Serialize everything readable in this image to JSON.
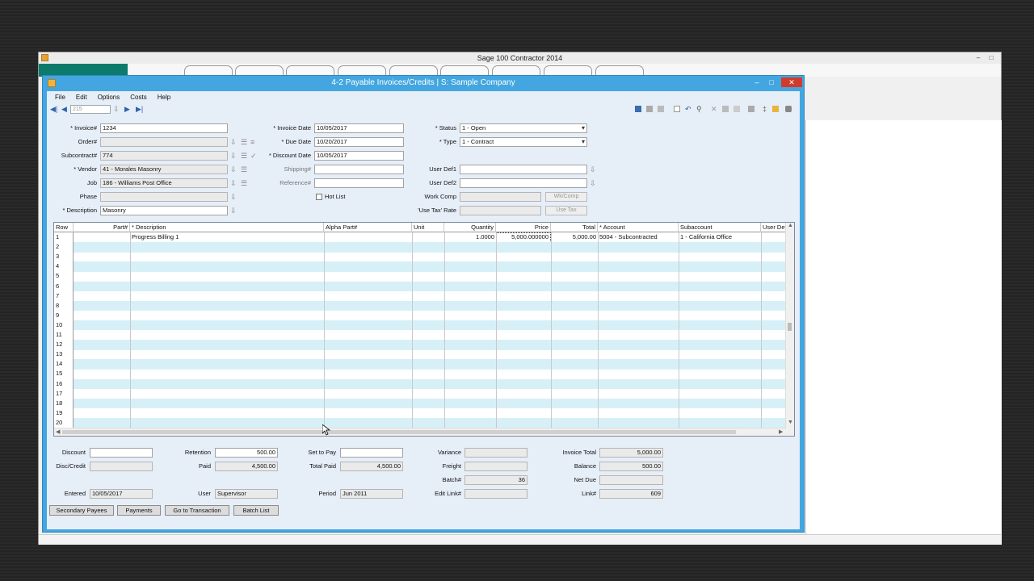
{
  "outer_window": {
    "title": "Sage 100 Contractor 2014",
    "controls": [
      "–",
      "□"
    ]
  },
  "window": {
    "title": "4-2 Payable Invoices/Credits  |  S: Sample Company",
    "controls": [
      "–",
      "□",
      "✕"
    ]
  },
  "menu": [
    "File",
    "Edit",
    "Options",
    "Costs",
    "Help"
  ],
  "toolbar": {
    "record_number": "215"
  },
  "header_left": [
    {
      "label": "* Invoice#",
      "value": "1234"
    },
    {
      "label": "Order#",
      "value": ""
    },
    {
      "label": "Subcontract#",
      "value": "774"
    },
    {
      "label": "* Vendor",
      "value": "41 - Morales Masonry"
    },
    {
      "label": "Job",
      "value": "186 - Williams Post Office"
    },
    {
      "label": "Phase",
      "value": ""
    },
    {
      "label": "* Description",
      "value": "Masonry"
    }
  ],
  "header_mid": [
    {
      "label": "* Invoice Date",
      "value": "10/05/2017"
    },
    {
      "label": "* Due Date",
      "value": "10/20/2017"
    },
    {
      "label": "* Discount Date",
      "value": "10/05/2017"
    },
    {
      "label": "Shipping#",
      "value": ""
    },
    {
      "label": "Reference#",
      "value": ""
    }
  ],
  "hot_list_label": "Hot List",
  "header_right": {
    "status_label": "* Status",
    "status_value": "1 - Open",
    "type_label": "* Type",
    "type_value": "1 - Contract",
    "userdef1_label": "User Def1",
    "userdef2_label": "User Def2",
    "workcomp_label": "Work Comp",
    "wkcomp_btn": "Wk/Comp",
    "usetax_label": "'Use Tax' Rate",
    "usetax_btn": "Use Tax"
  },
  "grid": {
    "columns": [
      "Row",
      "Part#",
      "* Description",
      "Alpha Part#",
      "Unit",
      "Quantity",
      "Price",
      "Total",
      "* Account",
      "Subaccount",
      "User Defi"
    ],
    "rows": [
      {
        "row": "1",
        "part": "",
        "description": "Progress Billing 1",
        "alpha": "",
        "unit": "",
        "quantity": "1.0000",
        "price": "5,000.000000",
        "total": "5,000.00",
        "account": "5004 - Subcontracted",
        "subaccount": "1 - California Office",
        "userdef": ""
      },
      {
        "row": "2"
      },
      {
        "row": "3"
      },
      {
        "row": "4"
      },
      {
        "row": "5"
      },
      {
        "row": "6"
      },
      {
        "row": "7"
      },
      {
        "row": "8"
      },
      {
        "row": "9"
      },
      {
        "row": "10"
      },
      {
        "row": "11"
      },
      {
        "row": "12"
      },
      {
        "row": "13"
      },
      {
        "row": "14"
      },
      {
        "row": "15"
      },
      {
        "row": "16"
      },
      {
        "row": "17"
      },
      {
        "row": "18"
      },
      {
        "row": "19"
      },
      {
        "row": "20"
      }
    ]
  },
  "totals": {
    "discount_label": "Discount",
    "discount": "",
    "disccredit_label": "Disc/Credit",
    "disccredit": "",
    "retention_label": "Retention",
    "retention": "500.00",
    "paid_label": "Paid",
    "paid": "4,500.00",
    "settopay_label": "Set to Pay",
    "settopay": "",
    "totalpaid_label": "Total Paid",
    "totalpaid": "4,500.00",
    "variance_label": "Variance",
    "variance": "",
    "freight_label": "Freight",
    "freight": "",
    "batch_label": "Batch#",
    "batch": "36",
    "editlink_label": "Edit Link#",
    "editlink": "",
    "invoicetotal_label": "Invoice Total",
    "invoicetotal": "5,000.00",
    "balance_label": "Balance",
    "balance": "500.00",
    "netdue_label": "Net Due",
    "netdue": "",
    "link_label": "Link#",
    "link": "609",
    "entered_label": "Entered",
    "entered": "10/05/2017",
    "user_label": "User",
    "user": "Supervisor",
    "period_label": "Period",
    "period": "Jun 2011"
  },
  "buttons": [
    "Secondary Payees",
    "Payments",
    "Go to Transaction",
    "Batch List"
  ],
  "colors": {
    "window_frame": "#43a6e0",
    "grid_alt_row": "#d7f0f7",
    "accent_teal": "#0c7b6b"
  }
}
